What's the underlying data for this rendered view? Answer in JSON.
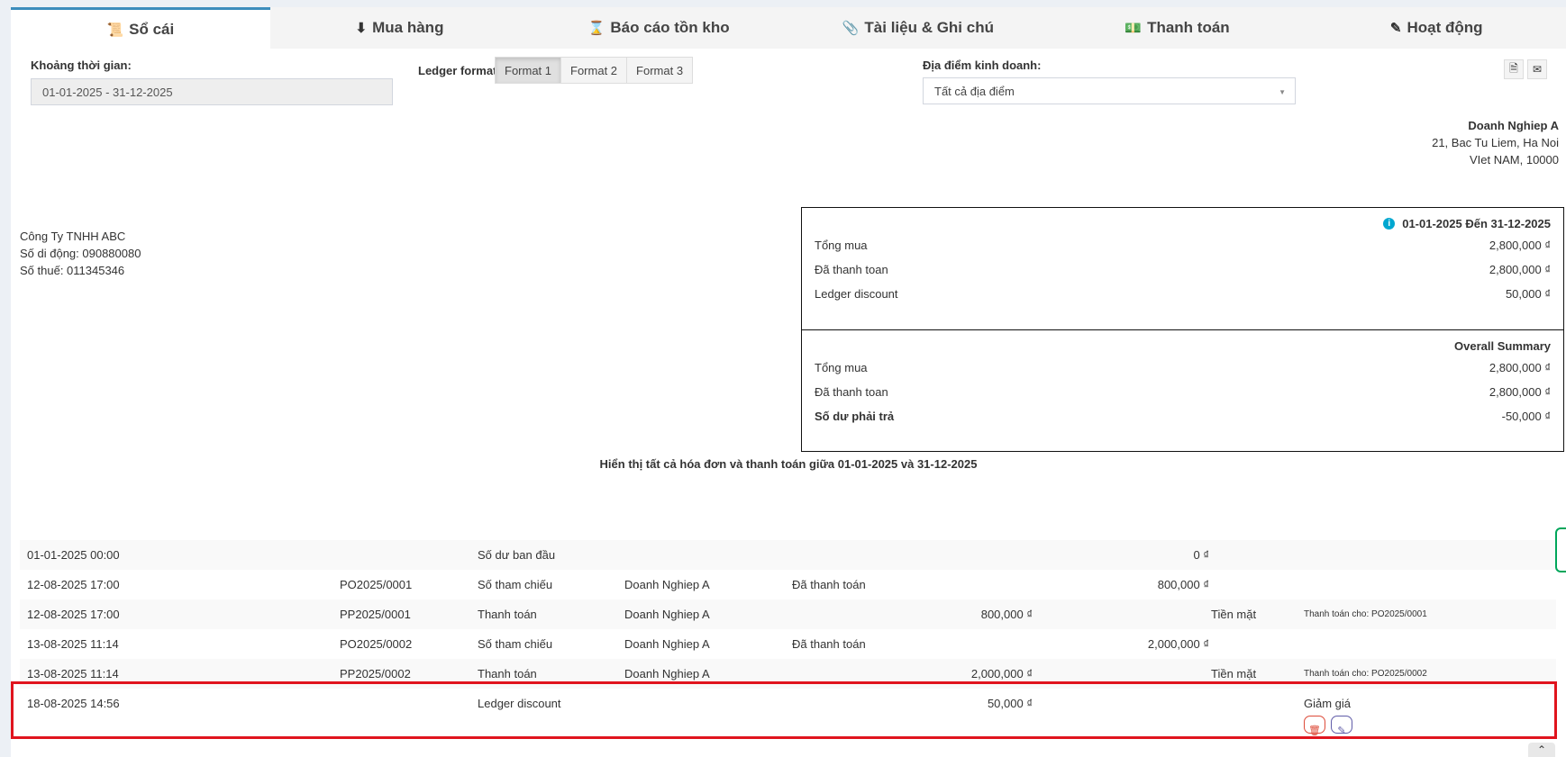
{
  "tabs": [
    {
      "label": "Sổ cái",
      "icon": "ledger-icon",
      "glyph": "📜",
      "active": true
    },
    {
      "label": "Mua hàng",
      "icon": "arrow-circle-down-icon",
      "glyph": "⬇",
      "active": false
    },
    {
      "label": "Báo cáo tồn kho",
      "icon": "hourglass-icon",
      "glyph": "⌛",
      "active": false
    },
    {
      "label": "Tài liệu & Ghi chú",
      "icon": "paperclip-icon",
      "glyph": "📎",
      "active": false
    },
    {
      "label": "Thanh toán",
      "icon": "money-icon",
      "glyph": "💵",
      "active": false
    },
    {
      "label": "Hoạt động",
      "icon": "edit-square-icon",
      "glyph": "✎",
      "active": false
    }
  ],
  "filters": {
    "date_label": "Khoảng thời gian:",
    "date_value": "01-01-2025 - 31-12-2025",
    "format_label": "Ledger format",
    "formats": [
      "Format 1",
      "Format 2",
      "Format 3"
    ],
    "active_format": "Format 1",
    "location_label": "Địa điểm kinh doanh:",
    "location_value": "Tất cả địa điểm"
  },
  "business": {
    "name": "Doanh Nghiep A",
    "address1": "21, Bac Tu Liem, Ha Noi",
    "address2": "VIet NAM, 10000"
  },
  "contact": {
    "name": "Công Ty TNHH ABC",
    "mobile": "Số di động: 090880080",
    "tax": "Số thuế: 011345346"
  },
  "summary_period": {
    "title": "01-01-2025 Đến 31-12-2025",
    "rows": [
      {
        "label": "Tổng mua",
        "value": "2,800,000 ₫"
      },
      {
        "label": "Đã thanh toan",
        "value": "2,800,000 ₫"
      },
      {
        "label": "Ledger discount",
        "value": "50,000 ₫"
      }
    ]
  },
  "summary_overall": {
    "title": "Overall Summary",
    "rows": [
      {
        "label": "Tổng mua",
        "value": "2,800,000 ₫"
      },
      {
        "label": "Đã thanh toan",
        "value": "2,800,000 ₫"
      },
      {
        "label": "Số dư phải trả",
        "value": "-50,000 ₫"
      }
    ]
  },
  "showing_text": "Hiển thị tất cả hóa đơn và thanh toán giữa 01-01-2025 và 31-12-2025",
  "ledger_rows": [
    {
      "date": "01-01-2025 00:00",
      "ref": "",
      "type": "Số dư ban đầu",
      "location": "",
      "status": "",
      "payment": "",
      "balance": "0 ₫",
      "method": "",
      "note": ""
    },
    {
      "date": "12-08-2025 17:00",
      "ref": "PO2025/0001",
      "type": "Số tham chiếu",
      "location": "Doanh Nghiep A",
      "status": "Đã thanh toán",
      "payment": "",
      "balance": "800,000 ₫",
      "method": "",
      "note": ""
    },
    {
      "date": "12-08-2025 17:00",
      "ref": "PP2025/0001",
      "type": "Thanh toán",
      "location": "Doanh Nghiep A",
      "status": "",
      "payment": "800,000 ₫",
      "balance": "",
      "method": "Tiền mặt",
      "note": "Thanh toán cho: PO2025/0001"
    },
    {
      "date": "13-08-2025 11:14",
      "ref": "PO2025/0002",
      "type": "Số tham chiếu",
      "location": "Doanh Nghiep A",
      "status": "Đã thanh toán",
      "payment": "",
      "balance": "2,000,000 ₫",
      "method": "",
      "note": ""
    },
    {
      "date": "13-08-2025 11:14",
      "ref": "PP2025/0002",
      "type": "Thanh toán",
      "location": "Doanh Nghiep A",
      "status": "",
      "payment": "2,000,000 ₫",
      "balance": "",
      "method": "Tiền mặt",
      "note": "Thanh toán cho: PO2025/0002"
    }
  ],
  "discount_row": {
    "date": "18-08-2025 14:56",
    "type": "Ledger discount",
    "payment": "50,000 ₫",
    "note": "Giảm giá"
  },
  "colors": {
    "accent": "#3c8dbc",
    "highlight": "#e0141e",
    "delete": "#dd4b39",
    "edit": "#605ca8",
    "info": "#00a7d0"
  }
}
